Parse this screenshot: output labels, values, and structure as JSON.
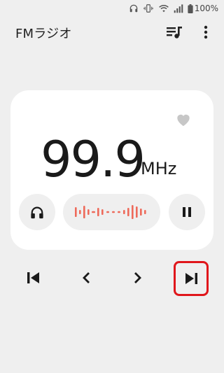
{
  "status_bar": {
    "battery_text": "100%"
  },
  "app_bar": {
    "title": "FMラジオ",
    "playlist_icon": "playlist-music-icon",
    "more_icon": "more-vertical-icon"
  },
  "card": {
    "frequency": "99.9",
    "unit": "MHz",
    "favorite_icon": "heart-icon",
    "headphone_icon": "headphones-icon",
    "pause_icon": "pause-icon",
    "tuner_icon": "frequency-tuner-icon"
  },
  "controls": {
    "prev_station_icon": "skip-previous-icon",
    "step_down_icon": "chevron-left-icon",
    "step_up_icon": "chevron-right-icon",
    "next_station_icon": "skip-next-icon"
  },
  "colors": {
    "background": "#efefef",
    "card": "#ffffff",
    "accent_wave": "#ee6a5a",
    "highlight": "#e0161b"
  }
}
